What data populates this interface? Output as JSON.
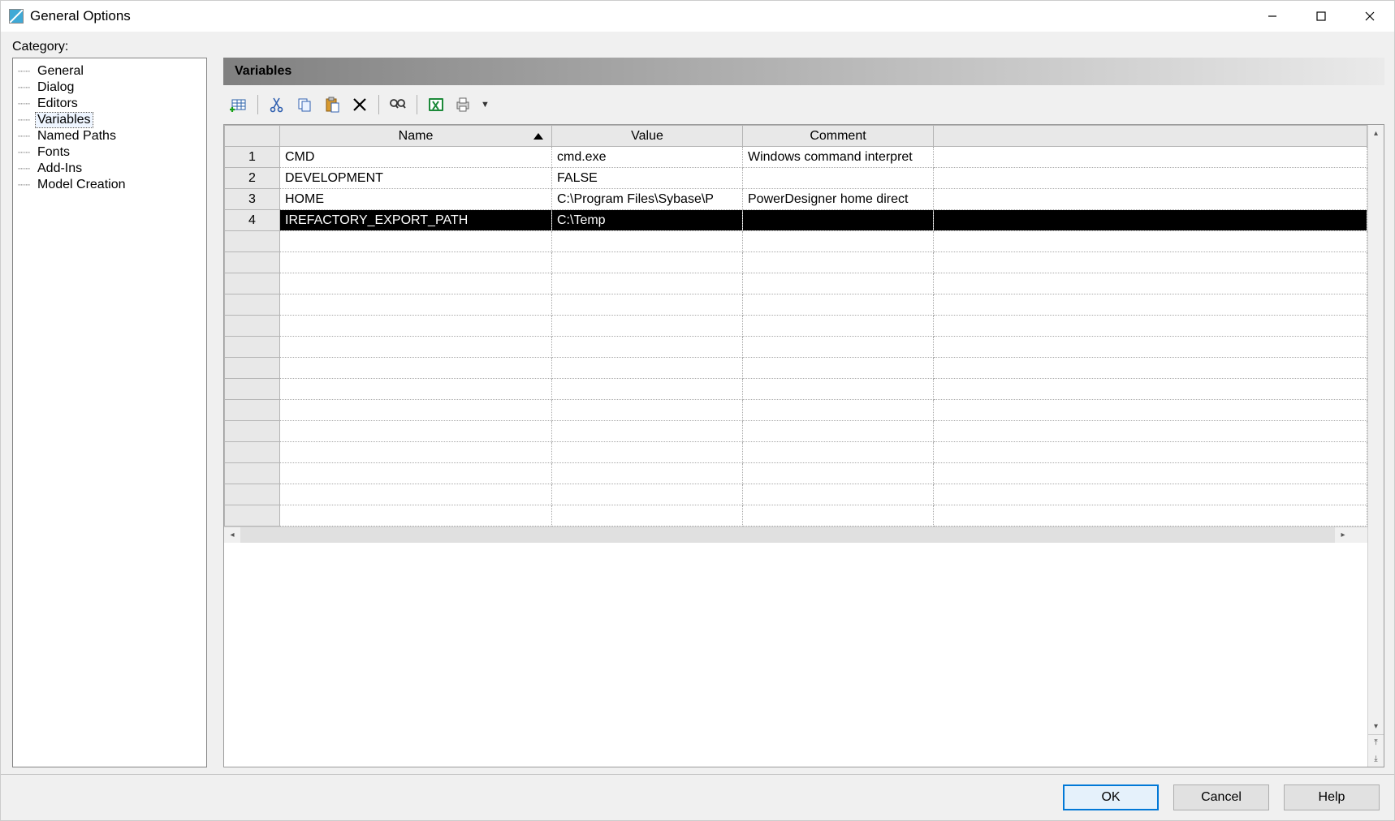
{
  "window": {
    "title": "General Options"
  },
  "sidebar": {
    "label": "Category:",
    "items": [
      {
        "label": "General"
      },
      {
        "label": "Dialog"
      },
      {
        "label": "Editors"
      },
      {
        "label": "Variables",
        "selected": true
      },
      {
        "label": "Named Paths"
      },
      {
        "label": "Fonts"
      },
      {
        "label": "Add-Ins"
      },
      {
        "label": "Model Creation"
      }
    ]
  },
  "panel": {
    "title": "Variables"
  },
  "toolbar": {
    "items": [
      "new-row",
      "cut",
      "copy",
      "paste",
      "delete",
      "find",
      "excel",
      "print"
    ]
  },
  "table": {
    "columns": [
      "Name",
      "Value",
      "Comment"
    ],
    "sort_column": 0,
    "sort_dir": "asc",
    "selected_row": 3,
    "rows": [
      {
        "n": "1",
        "name": "CMD",
        "value": "cmd.exe",
        "comment": "Windows command interpret"
      },
      {
        "n": "2",
        "name": "DEVELOPMENT",
        "value": "FALSE",
        "comment": ""
      },
      {
        "n": "3",
        "name": "HOME",
        "value": "C:\\Program Files\\Sybase\\P",
        "comment": "PowerDesigner home direct"
      },
      {
        "n": "4",
        "name": "IREFACTORY_EXPORT_PATH",
        "value": "C:\\Temp",
        "comment": ""
      }
    ],
    "blank_rows": 14
  },
  "footer": {
    "ok": "OK",
    "cancel": "Cancel",
    "help": "Help"
  }
}
